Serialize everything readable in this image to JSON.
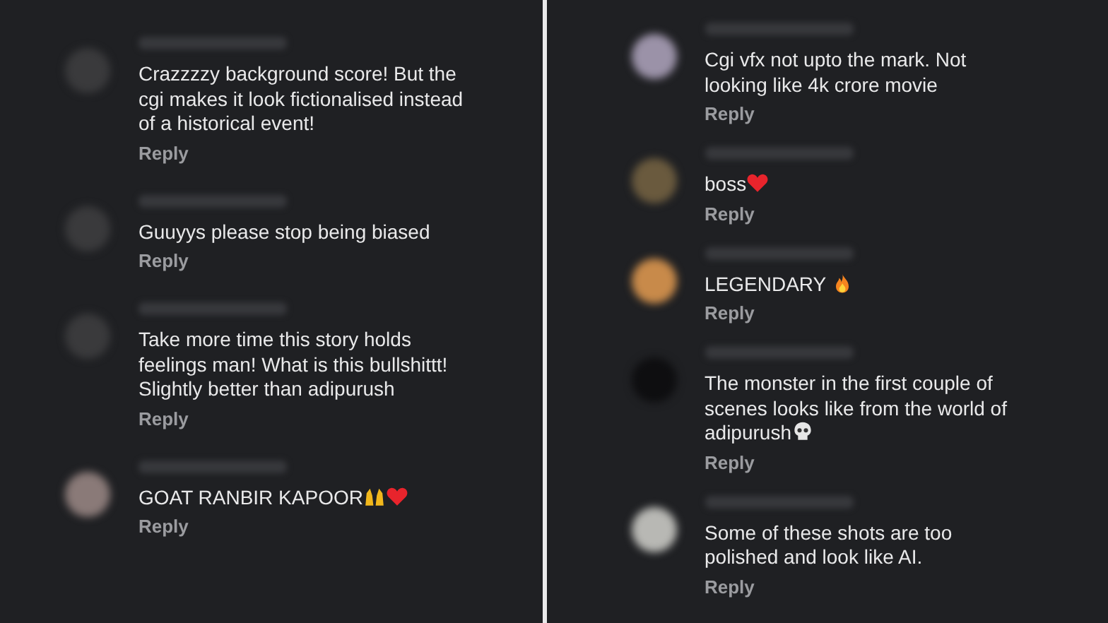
{
  "panels": [
    {
      "comments": [
        {
          "color": "#3a3a3c",
          "text": "Crazzzzy background score! But the cgi makes it look fictionalised instead of a historical event!",
          "reply": "Reply"
        },
        {
          "color": "#3a3a3c",
          "text": "Guuyys please stop being biased",
          "reply": "Reply"
        },
        {
          "color": "#3a3a3c",
          "text": "Take more time this story holds feelings man! What is this bullshittt! Slightly better than adipurush",
          "reply": "Reply"
        },
        {
          "color": "#8a7a78",
          "text": "GOAT RANBIR KAPOOR",
          "icons": [
            {
              "kind": "hands"
            },
            {
              "kind": "heart"
            }
          ],
          "reply": "Reply"
        }
      ]
    },
    {
      "comments": [
        {
          "color": "#9b92a8",
          "text": "Cgi vfx not upto the mark. Not looking like 4k crore movie",
          "reply": "Reply"
        },
        {
          "color": "#6a5a3e",
          "text": "boss",
          "icons": [
            {
              "kind": "heart"
            }
          ],
          "reply": "Reply"
        },
        {
          "color": "#c88a4a",
          "text": "LEGENDARY ",
          "icons": [
            {
              "kind": "fire"
            }
          ],
          "reply": "Reply"
        },
        {
          "color": "#0e0e10",
          "text": "The monster in the first couple of scenes looks like from the world of adipurush",
          "icons": [
            {
              "kind": "skull"
            }
          ],
          "reply": "Reply"
        },
        {
          "color": "#b8b8b4",
          "text": "Some of these shots are too polished and look like AI.",
          "reply": "Reply"
        }
      ]
    }
  ]
}
